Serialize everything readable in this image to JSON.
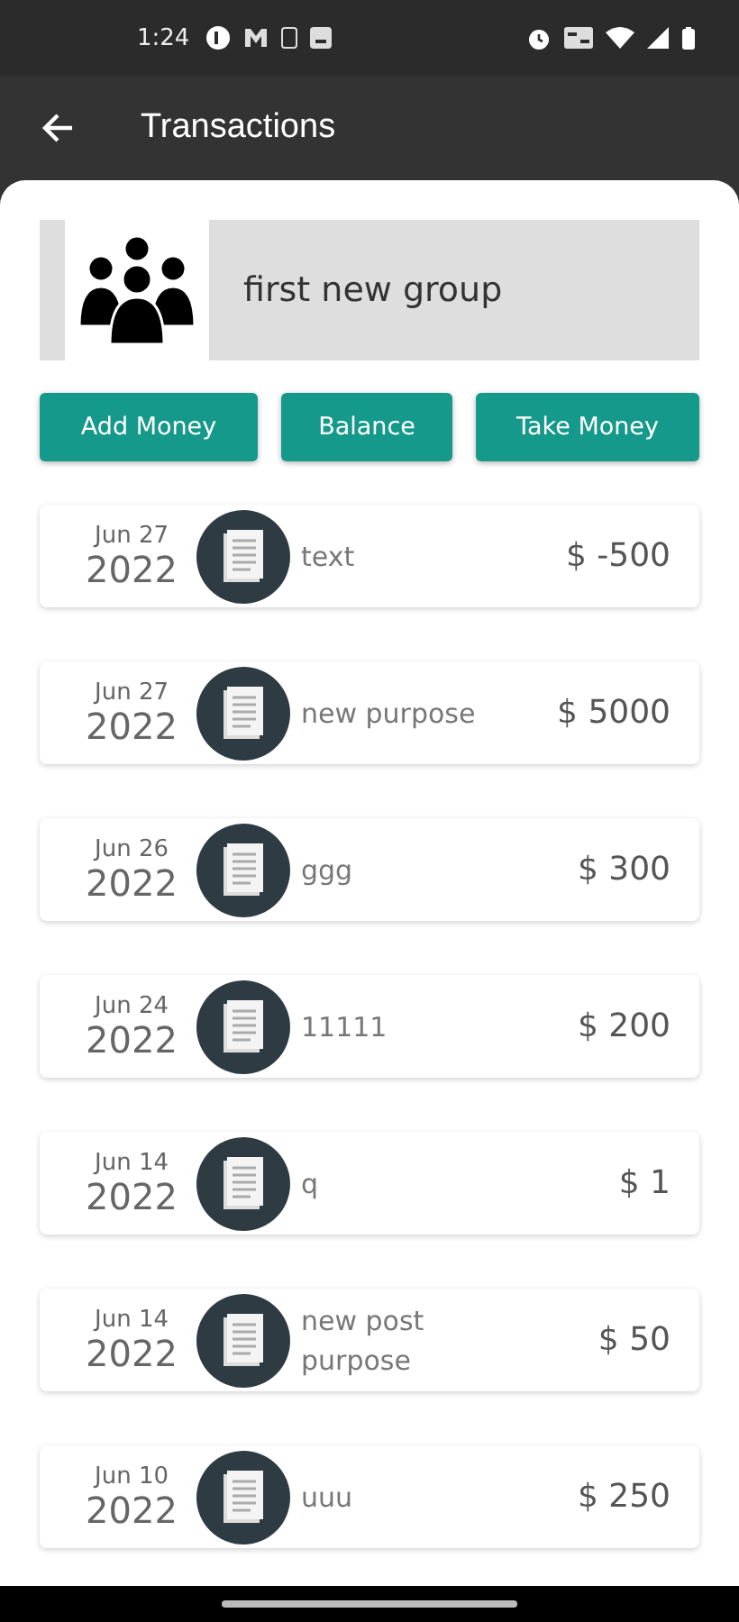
{
  "status_bar": {
    "time": "1:24"
  },
  "app_bar": {
    "title": "Transactions"
  },
  "group": {
    "name": "first new group"
  },
  "buttons": [
    "Add Money",
    "Balance",
    "Take Money"
  ],
  "transactions": [
    {
      "date": "Jun 27",
      "year": "2022",
      "purpose": "text",
      "amount": "$ -500"
    },
    {
      "date": "Jun 27",
      "year": "2022",
      "purpose": "new purpose",
      "amount": "$ 5000"
    },
    {
      "date": "Jun 26",
      "year": "2022",
      "purpose": "ggg",
      "amount": "$ 300"
    },
    {
      "date": "Jun 24",
      "year": "2022",
      "purpose": "11111",
      "amount": "$ 200"
    },
    {
      "date": "Jun 14",
      "year": "2022",
      "purpose": "q",
      "amount": "$ 1"
    },
    {
      "date": "Jun 14",
      "year": "2022",
      "purpose": "new post purpose",
      "amount": "$ 50"
    },
    {
      "date": "Jun 10",
      "year": "2022",
      "purpose": "uuu",
      "amount": "$ 250"
    }
  ]
}
